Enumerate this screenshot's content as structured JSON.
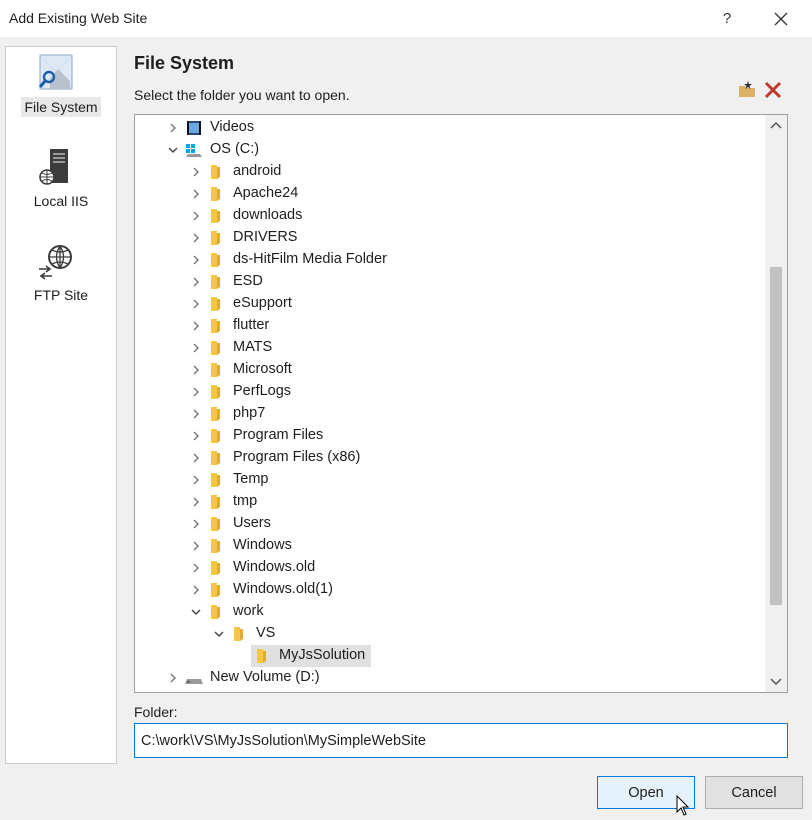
{
  "window": {
    "title": "Add Existing Web Site",
    "help_label": "?"
  },
  "sidebar": {
    "items": [
      {
        "label": "File System",
        "icon": "file-system-icon",
        "selected": true
      },
      {
        "label": "Local IIS",
        "icon": "server-icon",
        "selected": false
      },
      {
        "label": "FTP Site",
        "icon": "ftp-globe-icon",
        "selected": false
      }
    ]
  },
  "main": {
    "heading": "File System",
    "instruction": "Select the folder you want to open."
  },
  "tree": {
    "items": [
      {
        "label": "Videos",
        "depth": 0,
        "icon": "videos",
        "expanded": false
      },
      {
        "label": "OS (C:)",
        "depth": 0,
        "icon": "drive-os",
        "expanded": true
      },
      {
        "label": "android",
        "depth": 1,
        "icon": "folder",
        "expanded": false
      },
      {
        "label": "Apache24",
        "depth": 1,
        "icon": "folder",
        "expanded": false
      },
      {
        "label": "downloads",
        "depth": 1,
        "icon": "folder",
        "expanded": false
      },
      {
        "label": "DRIVERS",
        "depth": 1,
        "icon": "folder",
        "expanded": false
      },
      {
        "label": "ds-HitFilm Media Folder",
        "depth": 1,
        "icon": "folder",
        "expanded": false
      },
      {
        "label": "ESD",
        "depth": 1,
        "icon": "folder",
        "expanded": false
      },
      {
        "label": "eSupport",
        "depth": 1,
        "icon": "folder",
        "expanded": false
      },
      {
        "label": "flutter",
        "depth": 1,
        "icon": "folder",
        "expanded": false
      },
      {
        "label": "MATS",
        "depth": 1,
        "icon": "folder",
        "expanded": false
      },
      {
        "label": "Microsoft",
        "depth": 1,
        "icon": "folder",
        "expanded": false
      },
      {
        "label": "PerfLogs",
        "depth": 1,
        "icon": "folder",
        "expanded": false
      },
      {
        "label": "php7",
        "depth": 1,
        "icon": "folder",
        "expanded": false
      },
      {
        "label": "Program Files",
        "depth": 1,
        "icon": "folder",
        "expanded": false
      },
      {
        "label": "Program Files (x86)",
        "depth": 1,
        "icon": "folder",
        "expanded": false
      },
      {
        "label": "Temp",
        "depth": 1,
        "icon": "folder",
        "expanded": false
      },
      {
        "label": "tmp",
        "depth": 1,
        "icon": "folder",
        "expanded": false
      },
      {
        "label": "Users",
        "depth": 1,
        "icon": "folder",
        "expanded": false
      },
      {
        "label": "Windows",
        "depth": 1,
        "icon": "folder",
        "expanded": false
      },
      {
        "label": "Windows.old",
        "depth": 1,
        "icon": "folder",
        "expanded": false
      },
      {
        "label": "Windows.old(1)",
        "depth": 1,
        "icon": "folder",
        "expanded": false
      },
      {
        "label": "work",
        "depth": 1,
        "icon": "folder",
        "expanded": true
      },
      {
        "label": "VS",
        "depth": 2,
        "icon": "folder",
        "expanded": true
      },
      {
        "label": "MyJsSolution",
        "depth": 3,
        "icon": "folder",
        "leaf": true,
        "selected": true
      },
      {
        "label": "New Volume (D:)",
        "depth": 0,
        "icon": "drive",
        "expanded": false
      }
    ]
  },
  "folder": {
    "label": "Folder:",
    "value": "C:\\work\\VS\\MyJsSolution\\MySimpleWebSite"
  },
  "buttons": {
    "open": "Open",
    "cancel": "Cancel"
  },
  "colors": {
    "accent": "#0078d7",
    "folder": "#f5c642",
    "delete": "#c0392b"
  }
}
